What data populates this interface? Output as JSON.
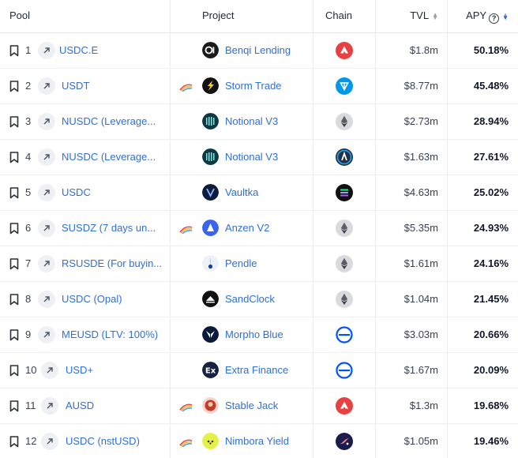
{
  "header": {
    "pool": "Pool",
    "project": "Project",
    "chain": "Chain",
    "tvl": "TVL",
    "apy": "APY",
    "apy_help": "?"
  },
  "colors": {
    "link": "#2f6fd6",
    "sort_active": "#2563eb"
  },
  "rows": [
    {
      "rank": "1",
      "pool": "USDC.E",
      "rewards": false,
      "project": "Benqi Lending",
      "project_icon": "benqi-logo",
      "chain_icon": "avalanche-icon",
      "tvl": "$1.8m",
      "apy": "50.18%"
    },
    {
      "rank": "2",
      "pool": "USDT",
      "rewards": true,
      "project": "Storm Trade",
      "project_icon": "storm-logo",
      "chain_icon": "ton-icon",
      "tvl": "$8.77m",
      "apy": "45.48%"
    },
    {
      "rank": "3",
      "pool": "NUSDC (Leverage...",
      "rewards": false,
      "project": "Notional V3",
      "project_icon": "notional-logo",
      "chain_icon": "ethereum-icon",
      "tvl": "$2.73m",
      "apy": "28.94%"
    },
    {
      "rank": "4",
      "pool": "NUSDC (Leverage...",
      "rewards": false,
      "project": "Notional V3",
      "project_icon": "notional-logo",
      "chain_icon": "arbitrum-icon",
      "tvl": "$1.63m",
      "apy": "27.61%"
    },
    {
      "rank": "5",
      "pool": "USDC",
      "rewards": false,
      "project": "Vaultka",
      "project_icon": "vaultka-logo",
      "chain_icon": "solana-icon",
      "tvl": "$4.63m",
      "apy": "25.02%"
    },
    {
      "rank": "6",
      "pool": "SUSDZ (7 days un...",
      "rewards": true,
      "project": "Anzen V2",
      "project_icon": "anzen-logo",
      "chain_icon": "ethereum-icon",
      "tvl": "$5.35m",
      "apy": "24.93%"
    },
    {
      "rank": "7",
      "pool": "RSUSDE (For buyin...",
      "rewards": false,
      "project": "Pendle",
      "project_icon": "pendle-logo",
      "chain_icon": "ethereum-icon",
      "tvl": "$1.61m",
      "apy": "24.16%"
    },
    {
      "rank": "8",
      "pool": "USDC (Opal)",
      "rewards": false,
      "project": "SandClock",
      "project_icon": "sandclock-logo",
      "chain_icon": "ethereum-icon",
      "tvl": "$1.04m",
      "apy": "21.45%"
    },
    {
      "rank": "9",
      "pool": "MEUSD (LTV: 100%)",
      "rewards": false,
      "project": "Morpho Blue",
      "project_icon": "morpho-logo",
      "chain_icon": "base-icon",
      "tvl": "$3.03m",
      "apy": "20.66%"
    },
    {
      "rank": "10",
      "pool": "USD+",
      "rewards": false,
      "project": "Extra Finance",
      "project_icon": "extra-finance-logo",
      "chain_icon": "base-icon",
      "tvl": "$1.67m",
      "apy": "20.09%"
    },
    {
      "rank": "11",
      "pool": "AUSD",
      "rewards": true,
      "project": "Stable Jack",
      "project_icon": "stable-jack-logo",
      "chain_icon": "avalanche-icon",
      "tvl": "$1.3m",
      "apy": "19.68%"
    },
    {
      "rank": "12",
      "pool": "USDC (nstUSD)",
      "rewards": true,
      "project": "Nimbora Yield",
      "project_icon": "nimbora-logo",
      "chain_icon": "starknet-icon",
      "tvl": "$1.05m",
      "apy": "19.46%"
    }
  ]
}
